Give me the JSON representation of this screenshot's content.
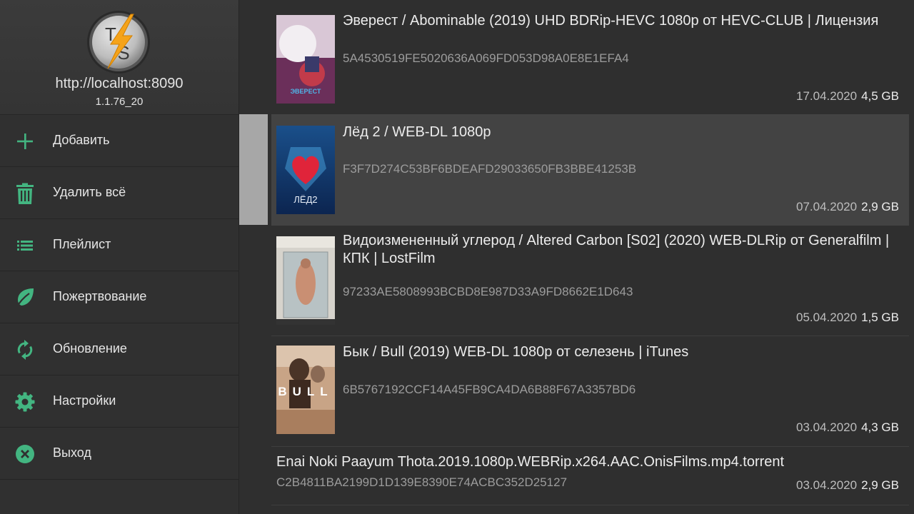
{
  "server": {
    "url": "http://localhost:8090",
    "version": "1.1.76_20",
    "logo_text": "TS"
  },
  "accent_color": "#43b581",
  "menu": [
    {
      "label": "Добавить",
      "icon": "plus-icon"
    },
    {
      "label": "Удалить всё",
      "icon": "trash-icon"
    },
    {
      "label": "Плейлист",
      "icon": "list-icon"
    },
    {
      "label": "Пожертвование",
      "icon": "leaf-icon"
    },
    {
      "label": "Обновление",
      "icon": "refresh-icon"
    },
    {
      "label": "Настройки",
      "icon": "gear-icon"
    },
    {
      "label": "Выход",
      "icon": "close-circle-icon"
    }
  ],
  "torrents": [
    {
      "title": "Эверест / Abominable (2019) UHD BDRip-HEVC 1080p от HEVC-CLUB | Лицензия",
      "hash": "5A4530519FE5020636A069FD053D98A0E8E1EFA4",
      "date": "17.04.2020",
      "size": "4,5 GB",
      "poster_text": "ЭВЕРЕСТ",
      "selected": false
    },
    {
      "title": "Лёд 2 / WEB-DL 1080p",
      "hash": "F3F7D274C53BF6BDEAFD29033650FB3BBE41253B",
      "date": "07.04.2020",
      "size": "2,9 GB",
      "poster_text": "ЛЁД2",
      "selected": true
    },
    {
      "title": "Видоизмененный углерод / Altered Carbon [S02] (2020) WEB-DLRip от Generalfilm | КПК | LostFilm",
      "hash": "97233AE5808993BCBD8E987D33A9FD8662E1D643",
      "date": "05.04.2020",
      "size": "1,5 GB",
      "poster_text": "",
      "selected": false
    },
    {
      "title": "Бык / Bull (2019) WEB-DL 1080p от селезень | iTunes",
      "hash": "6B5767192CCF14A45FB9CA4DA6B88F67A3357BD6",
      "date": "03.04.2020",
      "size": "4,3 GB",
      "poster_text": "BULL",
      "selected": false
    },
    {
      "title": "Enai Noki Paayum Thota.2019.1080p.WEBRip.x264.AAC.OnisFilms.mp4.torrent",
      "hash": "C2B4811BA2199D1D139E8390E74ACBC352D25127",
      "date": "03.04.2020",
      "size": "2,9 GB",
      "poster_text": "",
      "selected": false
    }
  ]
}
